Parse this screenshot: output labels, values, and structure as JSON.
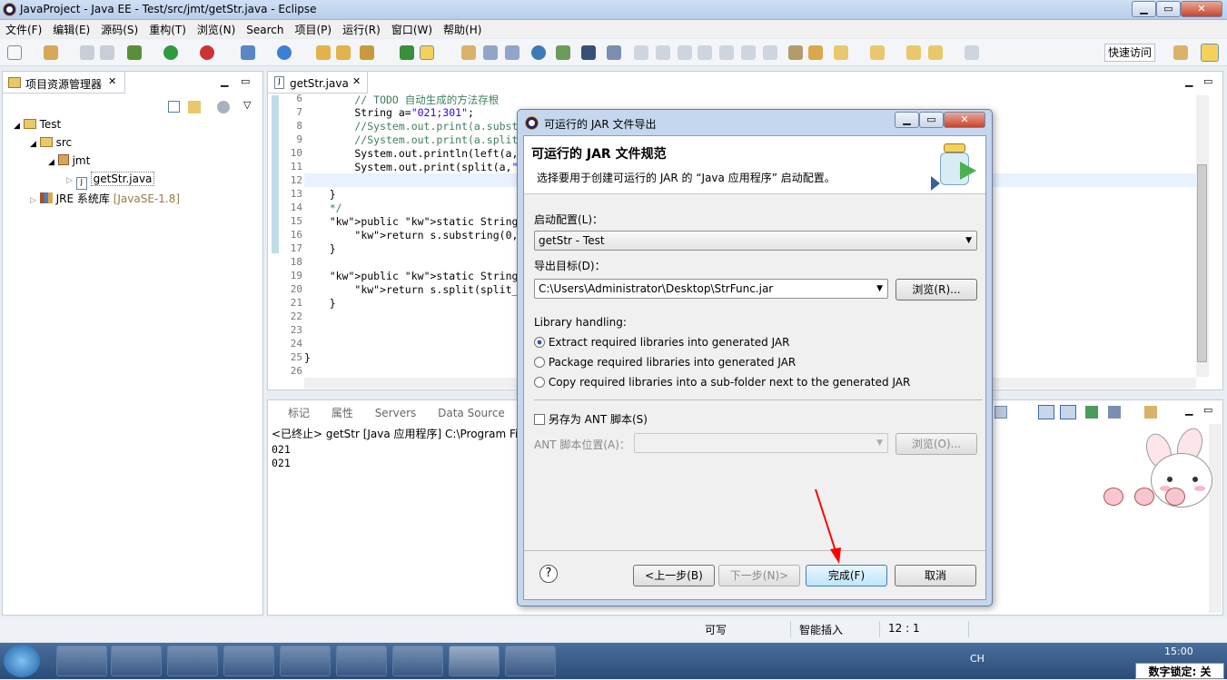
{
  "window": {
    "title": "JavaProject - Java EE - Test/src/jmt/getStr.java - Eclipse"
  },
  "menu": [
    "文件(F)",
    "编辑(E)",
    "源码(S)",
    "重构(T)",
    "浏览(N)",
    "Search",
    "项目(P)",
    "运行(R)",
    "窗口(W)",
    "帮助(H)"
  ],
  "toolbar": {
    "quick_access": "快速访问"
  },
  "explorer": {
    "title": "项目资源管理器",
    "items": [
      {
        "label": "Test"
      },
      {
        "label": "src"
      },
      {
        "label": "jmt"
      },
      {
        "label": "getStr.java"
      },
      {
        "label": "JRE 系统库"
      }
    ],
    "jre_suffix": "[JavaSE-1.8]"
  },
  "editor": {
    "tab": "getStr.java",
    "line_numbers": [
      "6",
      "7",
      "8",
      "9",
      "10",
      "11",
      "12",
      "13",
      "14",
      "15",
      "16",
      "17",
      "18",
      "19",
      "20",
      "21",
      "22",
      "23",
      "24",
      "25",
      "26"
    ],
    "lines": [
      "        // TODO 自动生成的方法存根",
      "        String a=\"021;301\";",
      "        //System.out.print(a.subst",
      "        //System.out.print(a.split",
      "        System.out.println(left(a,",
      "        System.out.print(split(a,\"",
      "",
      "    }",
      "    */",
      "    public static String left(Stri",
      "        return s.substring(0,n);",
      "    }",
      "",
      "    public static String split(Str",
      "        return s.split(split_s)[0]",
      "    }",
      "",
      "",
      "",
      "}",
      ""
    ]
  },
  "console": {
    "tabs": [
      "标记",
      "属性",
      "Servers",
      "Data Source"
    ],
    "header": "<已终止> getStr [Java 应用程序] C:\\Program File",
    "output": [
      "021",
      "021"
    ]
  },
  "dialog": {
    "title": "可运行的 JAR 文件导出",
    "heading": "可运行的 JAR 文件规范",
    "description": "选择要用于创建可运行的 JAR 的 “Java 应用程序” 启动配置。",
    "launch_label": "启动配置(L)：",
    "launch_value": "getStr - Test",
    "export_label": "导出目标(D)：",
    "export_value": "C:\\Users\\Administrator\\Desktop\\StrFunc.jar",
    "browse": "浏览(R)...",
    "lib_label": "Library handling:",
    "lib_options": [
      "Extract required libraries into generated JAR",
      "Package required libraries into generated JAR",
      "Copy required libraries into a sub-folder next to the generated JAR"
    ],
    "ant_checkbox": "另存为 ANT 脚本(S)",
    "ant_location": "ANT 脚本位置(A)：",
    "ant_browse": "浏览(O)...",
    "back": "<上一步(B)",
    "next": "下一步(N)>",
    "finish": "完成(F)",
    "cancel": "取消",
    "help": "?"
  },
  "statusbar": {
    "writable": "可写",
    "insert": "智能插入",
    "position": "12 : 1"
  },
  "taskbar": {
    "time": "15:00",
    "numlock": "数字锁定: 关",
    "lang": "CH"
  },
  "colors": {
    "accent": "#3399ff",
    "arrow": "#ff0000"
  }
}
